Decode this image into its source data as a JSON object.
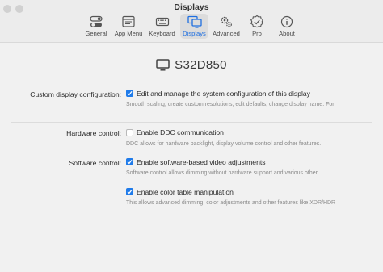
{
  "window": {
    "title": "Displays"
  },
  "tabs": [
    {
      "label": "General",
      "icon": "toggles-icon",
      "active": false
    },
    {
      "label": "App Menu",
      "icon": "app-menu-icon",
      "active": false
    },
    {
      "label": "Keyboard",
      "icon": "keyboard-icon",
      "active": false
    },
    {
      "label": "Displays",
      "icon": "displays-icon",
      "active": true
    },
    {
      "label": "Advanced",
      "icon": "gears-icon",
      "active": false
    },
    {
      "label": "Pro",
      "icon": "pro-badge-icon",
      "active": false
    },
    {
      "label": "About",
      "icon": "info-icon",
      "active": false
    }
  ],
  "display": {
    "name": "S32D850",
    "icon": "monitor-icon"
  },
  "settings": {
    "custom": {
      "label": "Custom display configuration:",
      "option": "Edit and manage the system configuration of this display",
      "checked": true,
      "description": "Smooth scaling, create custom resolutions, edit defaults, change display name. For"
    },
    "hardware": {
      "label": "Hardware control:",
      "option": "Enable DDC communication",
      "checked": false,
      "description": "DDC allows for hardware backlight, display volume control and other features."
    },
    "software": {
      "label": "Software control:",
      "option": "Enable software-based video adjustments",
      "checked": true,
      "description": "Software control allows dimming without hardware support and  various other"
    },
    "colortable": {
      "option": "Enable color table manipulation",
      "checked": true,
      "description": "This allows advanced dimming, color adjustments and other features like XDR/HDR"
    }
  },
  "colors": {
    "accent": "#1f7bea",
    "active_tab_text": "#1f6fe0"
  }
}
